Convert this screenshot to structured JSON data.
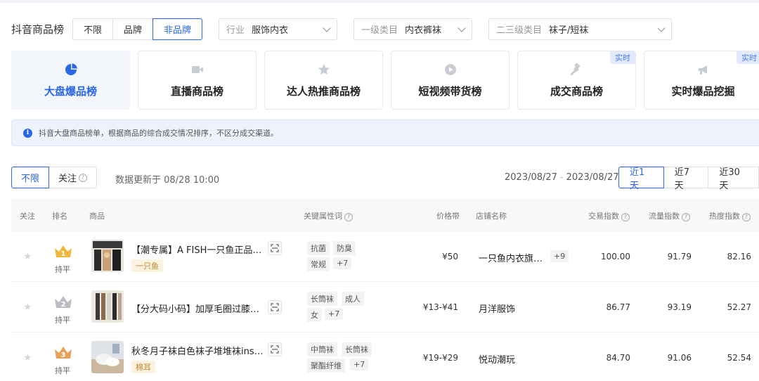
{
  "filters": {
    "title": "抖音商品榜",
    "brand_options": [
      "不限",
      "品牌",
      "非品牌"
    ],
    "industry": {
      "label": "行业",
      "value": "服饰内衣"
    },
    "category1": {
      "label": "一级类目",
      "value": "内衣裤袜"
    },
    "category23": {
      "label": "二三级类目",
      "value": "袜子/短袜"
    }
  },
  "tabs": [
    {
      "label": "大盘爆品榜",
      "icon": "pie-chart-icon",
      "active": true
    },
    {
      "label": "直播商品榜",
      "icon": "video-icon"
    },
    {
      "label": "达人热推商品榜",
      "icon": "star-badge-icon"
    },
    {
      "label": "短视频带货榜",
      "icon": "play-icon"
    },
    {
      "label": "成交商品榜",
      "icon": "gavel-icon",
      "badge": "实时"
    },
    {
      "label": "实时爆品挖掘",
      "icon": "megaphone-icon",
      "badge": "实时"
    }
  ],
  "info": {
    "icon": "info-icon",
    "text": "抖音大盘商品榜单，根据商品的综合成交情况排序，不区分成交渠道。"
  },
  "controls": {
    "filter_all": "不限",
    "filter_follow": "关注",
    "update_text": "数据更新于 08/28 10:00",
    "date_start": "2023/08/27",
    "date_sep": "-",
    "date_end": "2023/08/27",
    "ranges": [
      "近1天",
      "近7天",
      "近30天"
    ]
  },
  "table": {
    "headers": {
      "follow": "关注",
      "rank": "排名",
      "product": "商品",
      "keywords": "关键属性词",
      "price": "价格带",
      "shop": "店铺名称",
      "trade": "交易指数",
      "traffic": "流量指数",
      "heat": "热度指数"
    },
    "rows": [
      {
        "rank": 1,
        "rank_color": "#f0b73a",
        "rank_change": "持平",
        "name": "【潮专属】A FISH一只鱼正品…",
        "tag": "一只鱼",
        "keywords": [
          "抗菌",
          "防臭",
          "常规",
          "+7"
        ],
        "price": "¥50",
        "shop": "一只鱼内衣旗…",
        "shop_more": "+9",
        "trade": "100.00",
        "traffic": "91.79",
        "heat": "82.16"
      },
      {
        "rank": 2,
        "rank_color": "#b9bcc2",
        "rank_change": "持平",
        "name": "【分大码小码】加厚毛圈过膝…",
        "tag": "",
        "keywords": [
          "长筒袜",
          "成人",
          "女",
          "+7"
        ],
        "price": "¥13-¥41",
        "shop": "月洋服饰",
        "shop_more": "",
        "trade": "86.77",
        "traffic": "93.19",
        "heat": "52.27"
      },
      {
        "rank": 3,
        "rank_color": "#e6a25a",
        "rank_change": "持平",
        "name": "秋冬月子袜白色袜子堆堆袜ins…",
        "tag": "棉耳",
        "keywords": [
          "中筒袜",
          "长筒袜",
          "聚酯纤维",
          "+7"
        ],
        "price": "¥19-¥29",
        "shop": "悦动潮玩",
        "shop_more": "",
        "trade": "84.70",
        "traffic": "91.06",
        "heat": "52.54"
      }
    ]
  }
}
